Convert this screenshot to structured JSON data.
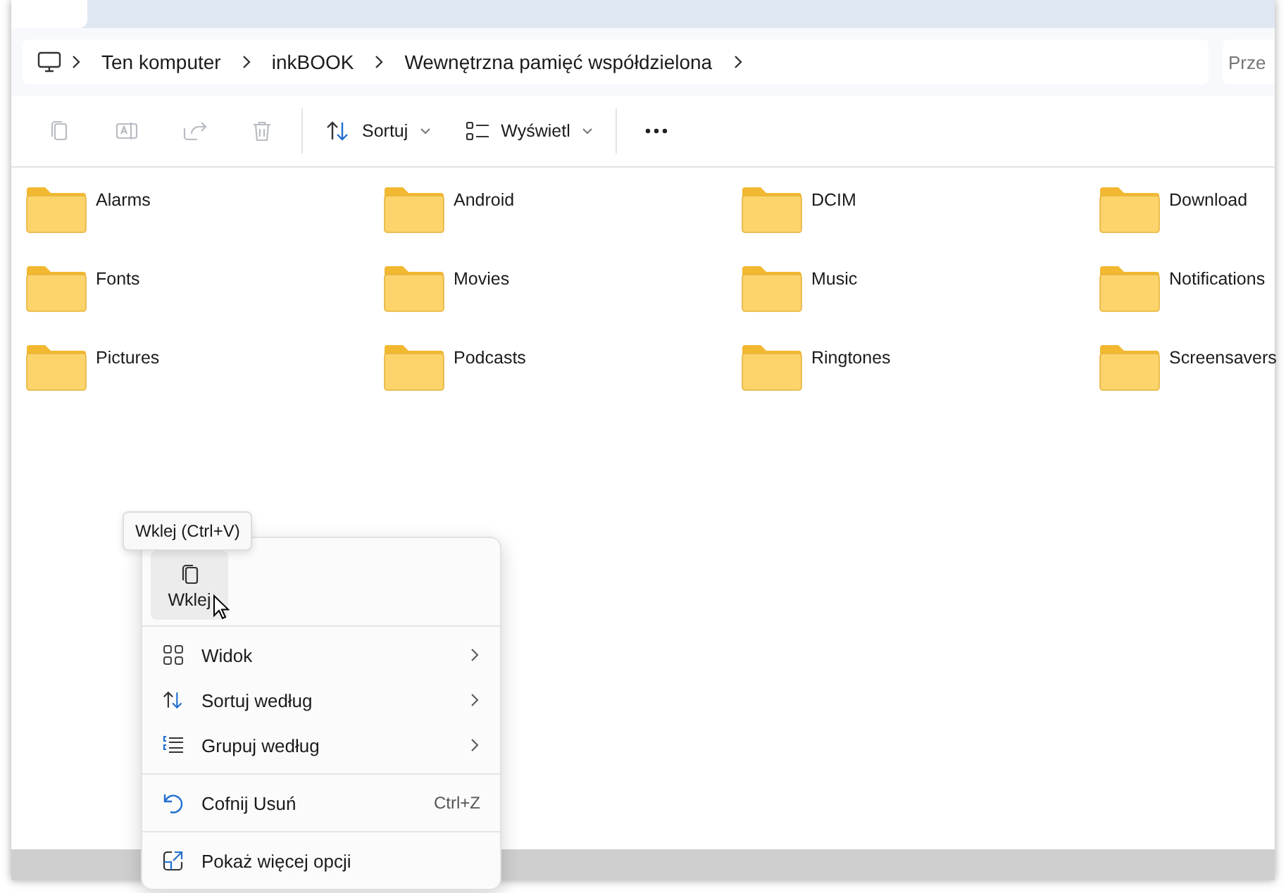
{
  "address_bar": {
    "breadcrumb": [
      "Ten komputer",
      "inkBOOK",
      "Wewnętrzna pamięć współdzielona"
    ]
  },
  "search": {
    "placeholder": "Prze"
  },
  "toolbar": {
    "icon_buttons": [
      {
        "kind": "copy",
        "disabled": true
      },
      {
        "kind": "rename",
        "disabled": true
      },
      {
        "kind": "share",
        "disabled": true
      },
      {
        "kind": "delete",
        "disabled": true
      }
    ],
    "menus": [
      {
        "kind": "sort",
        "label": "Sortuj"
      },
      {
        "kind": "view",
        "label": "Wyświetl"
      }
    ]
  },
  "folders": [
    "Alarms",
    "Android",
    "DCIM",
    "Download",
    "Fonts",
    "Movies",
    "Music",
    "Notifications",
    "Pictures",
    "Podcasts",
    "Ringtones",
    "Screensavers"
  ],
  "context_menu": {
    "top_action": {
      "label": "Wklej",
      "tooltip": "Wklej (Ctrl+V)"
    },
    "groups": [
      [
        {
          "kind": "view",
          "label": "Widok",
          "submenu": true
        },
        {
          "kind": "sort",
          "label": "Sortuj według",
          "submenu": true
        },
        {
          "kind": "group",
          "label": "Grupuj według",
          "submenu": true
        }
      ],
      [
        {
          "kind": "undo",
          "label": "Cofnij Usuń",
          "shortcut": "Ctrl+Z",
          "submenu": false
        }
      ],
      [
        {
          "kind": "more",
          "label": "Pokaż więcej opcji",
          "submenu": false
        }
      ]
    ]
  }
}
